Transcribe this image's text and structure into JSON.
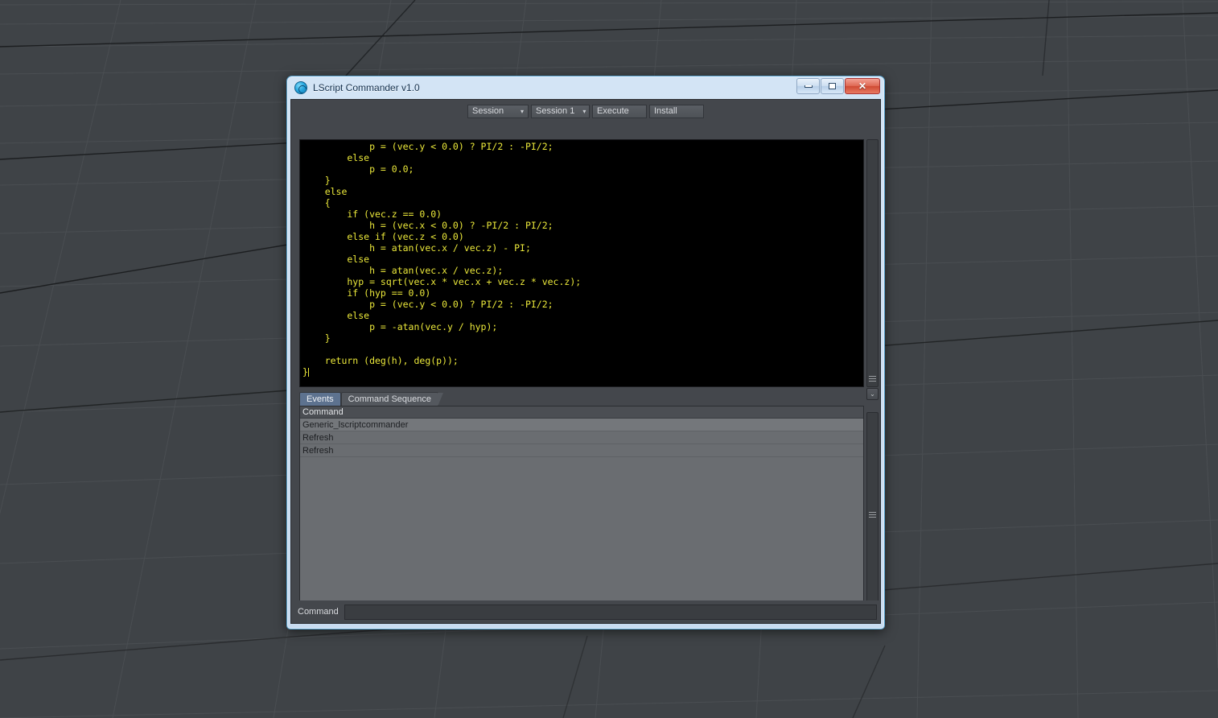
{
  "desktop": {
    "background_color": "#3f4347",
    "grid_line_color": "#4a4e52",
    "grid_dark_line_color": "#1c1e20"
  },
  "window": {
    "title": "LScript Commander v1.0",
    "icon": "lscript-spiral-icon",
    "frame_color": "#cfe0f2",
    "frame_border_color": "#5ba4cf",
    "controls": {
      "minimize_label": "–",
      "restore_label": "□",
      "close_label": "✕"
    }
  },
  "toolbar": {
    "session_type_value": "Session",
    "session_value": "Session 1",
    "execute_label": "Execute",
    "install_label": "Install",
    "dropdown_arrow": "▾"
  },
  "editor": {
    "language": "lscript",
    "text_color": "#ebe83a",
    "background_color": "#000000",
    "code": "            p = (vec.y < 0.0) ? PI/2 : -PI/2;\n        else\n            p = 0.0;\n    }\n    else\n    {\n        if (vec.z == 0.0)\n            h = (vec.x < 0.0) ? -PI/2 : PI/2;\n        else if (vec.z < 0.0)\n            h = atan(vec.x / vec.z) - PI;\n        else\n            h = atan(vec.x / vec.z);\n        hyp = sqrt(vec.x * vec.x + vec.z * vec.z);\n        if (hyp == 0.0)\n            p = (vec.y < 0.0) ? PI/2 : -PI/2;\n        else\n            p = -atan(vec.y / hyp);\n    }\n\n    return (deg(h), deg(p));\n}"
  },
  "tabs": [
    {
      "label": "Events",
      "active": true
    },
    {
      "label": "Command Sequence",
      "active": false
    }
  ],
  "list": {
    "columns": [
      "Command"
    ],
    "rows": [
      {
        "command": "Generic_lscriptcommander"
      },
      {
        "command": "Refresh"
      },
      {
        "command": "Refresh"
      }
    ]
  },
  "command_bar": {
    "label": "Command",
    "value": "",
    "placeholder": ""
  },
  "scrollbars": {
    "editor_chevron": "⌄",
    "grip_icon": "grip-lines-icon"
  }
}
